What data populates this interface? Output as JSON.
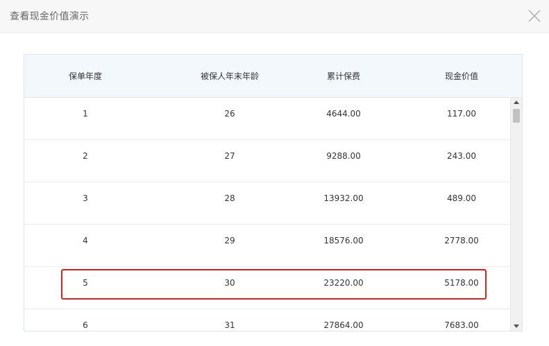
{
  "dialog": {
    "title": "查看现金价值演示",
    "close_icon": "close-icon"
  },
  "table": {
    "headers": [
      "保单年度",
      "被保人年末年龄",
      "累计保费",
      "现金价值"
    ],
    "rows": [
      [
        "1",
        "26",
        "4644.00",
        "117.00"
      ],
      [
        "2",
        "27",
        "9288.00",
        "243.00"
      ],
      [
        "3",
        "28",
        "13932.00",
        "489.00"
      ],
      [
        "4",
        "29",
        "18576.00",
        "2778.00"
      ],
      [
        "5",
        "30",
        "23220.00",
        "5178.00"
      ],
      [
        "6",
        "31",
        "27864.00",
        "7683.00"
      ]
    ],
    "highlighted_row_index": 4
  },
  "colors": {
    "header_bg": "#f3f8fd",
    "highlight": "#e0201a"
  }
}
